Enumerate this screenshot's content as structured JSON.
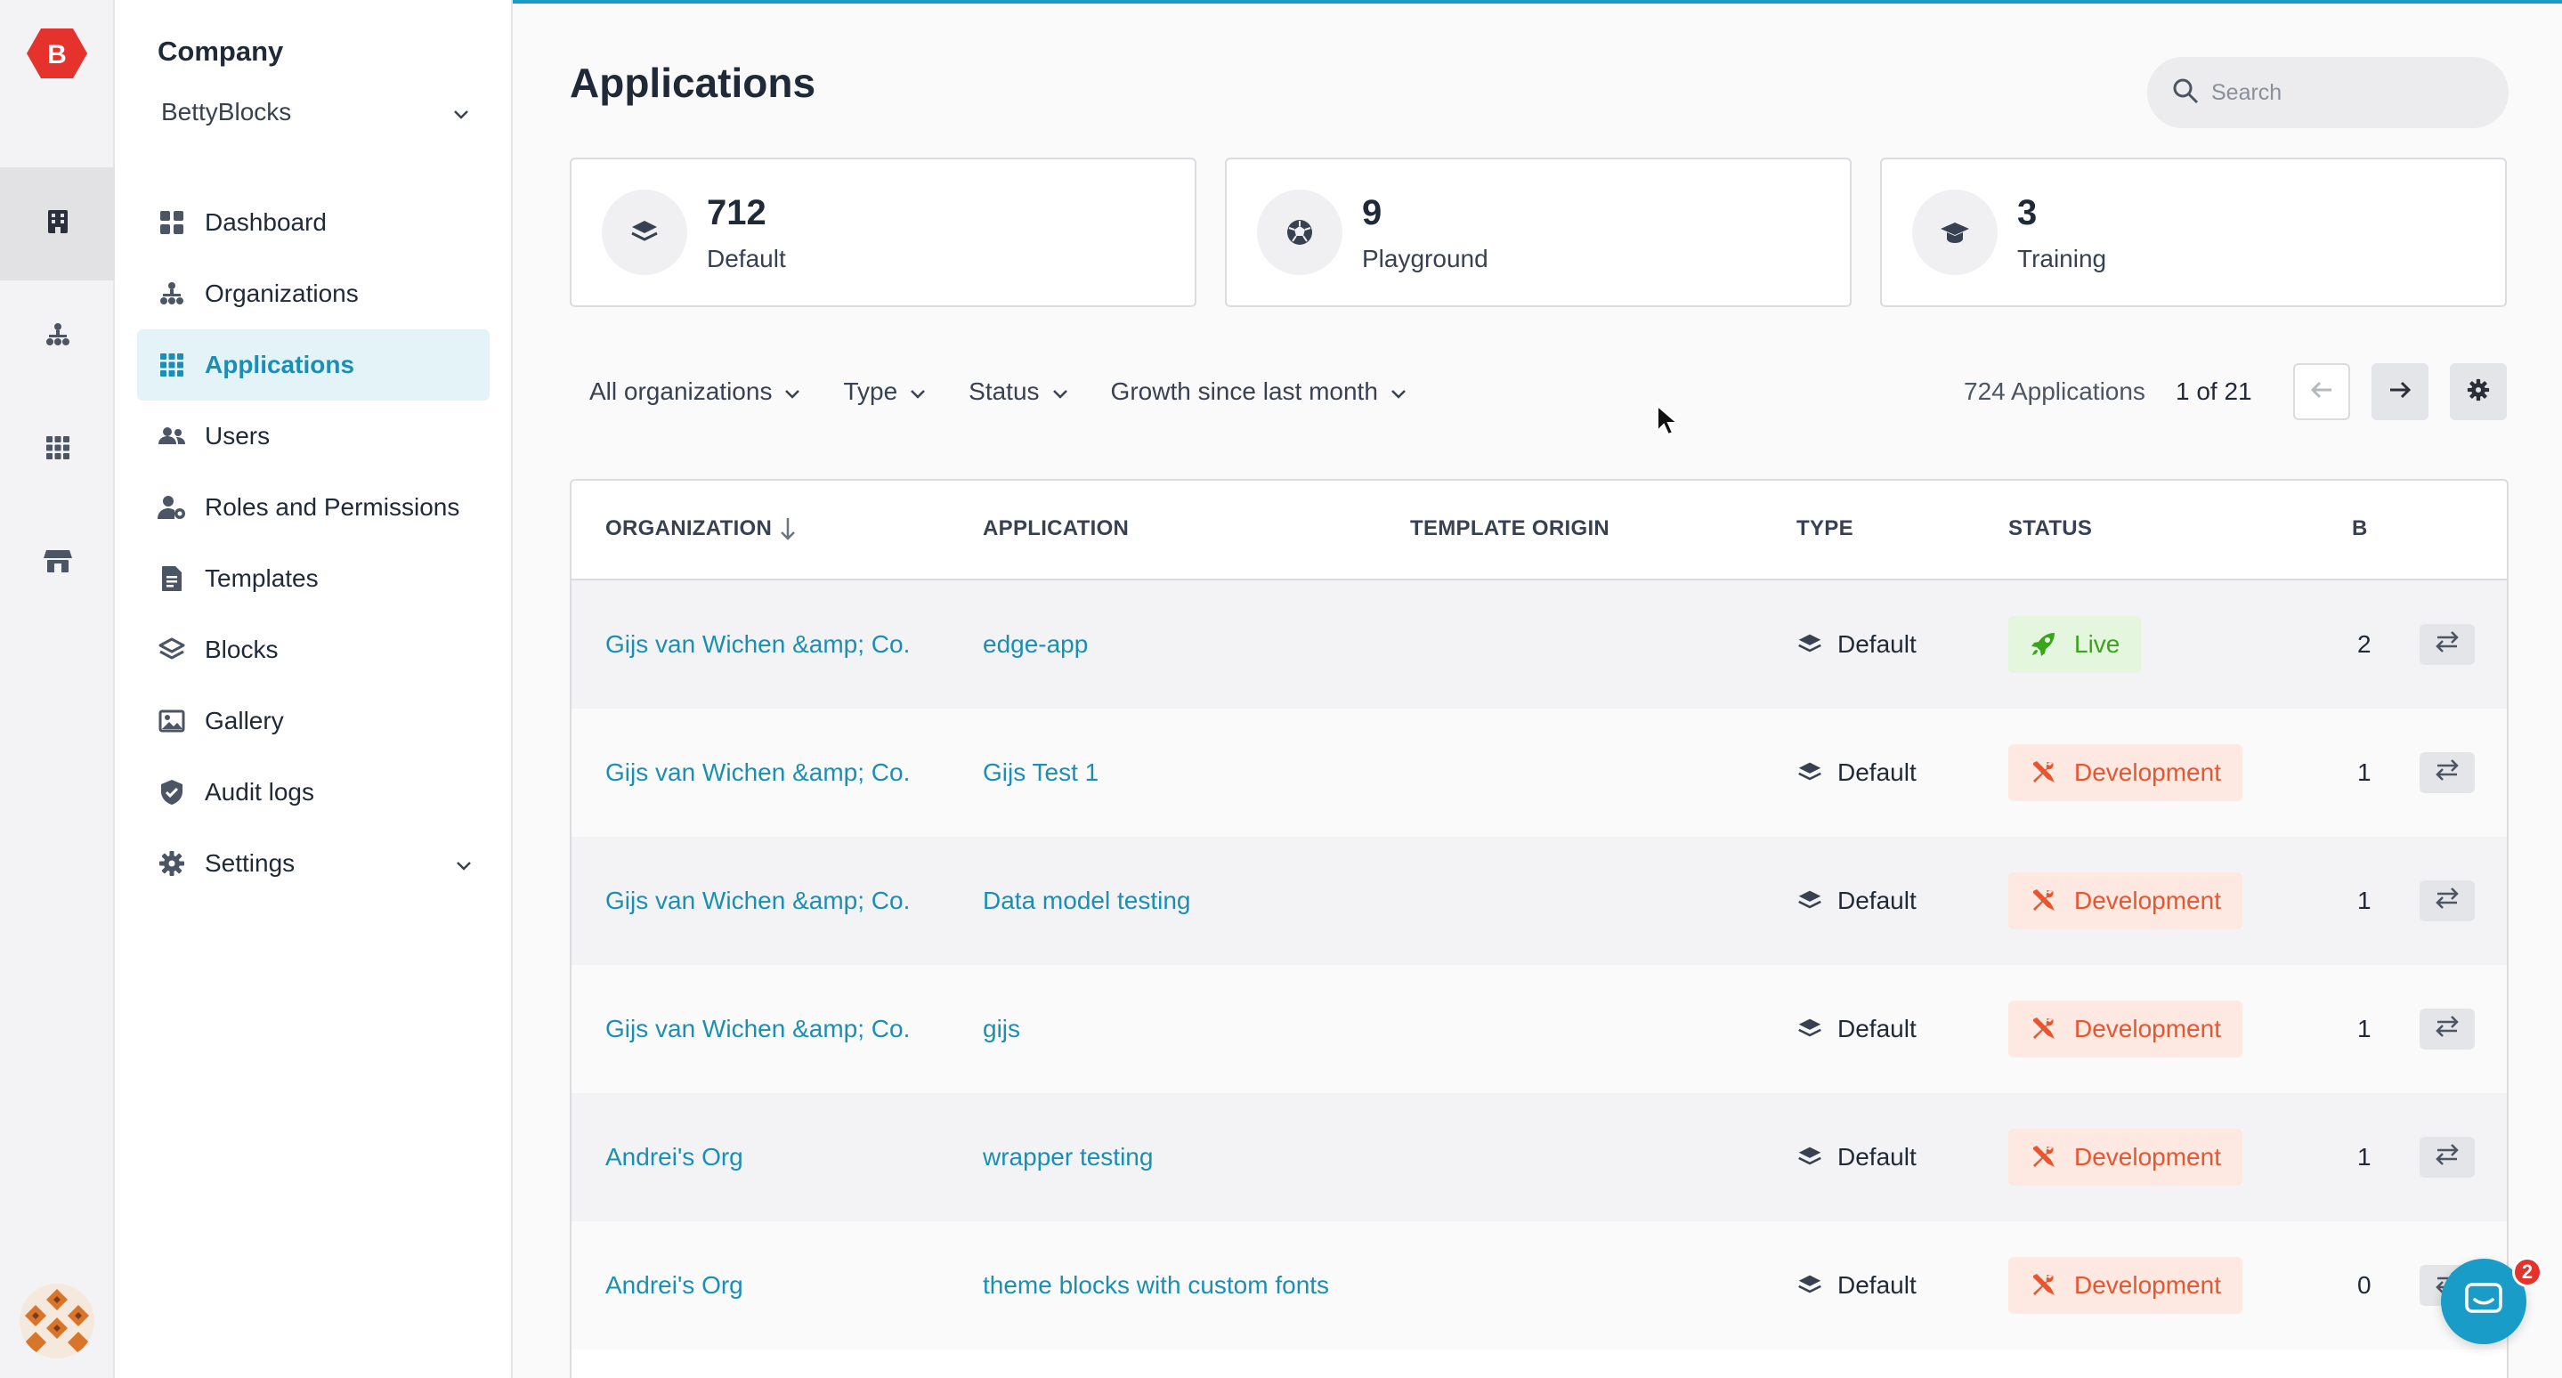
{
  "rail": {
    "logo_letter": "B",
    "items": [
      "building-icon",
      "org-tree-icon",
      "apps-grid-icon",
      "store-icon"
    ]
  },
  "sidebar": {
    "title": "Company",
    "company": "BettyBlocks",
    "items": [
      {
        "label": "Dashboard",
        "icon": "dashboard-icon"
      },
      {
        "label": "Organizations",
        "icon": "org-tree-icon"
      },
      {
        "label": "Applications",
        "icon": "apps-grid-icon",
        "active": true
      },
      {
        "label": "Users",
        "icon": "users-icon"
      },
      {
        "label": "Roles and Permissions",
        "icon": "user-gear-icon"
      },
      {
        "label": "Templates",
        "icon": "document-icon"
      },
      {
        "label": "Blocks",
        "icon": "layers-icon"
      },
      {
        "label": "Gallery",
        "icon": "image-icon"
      },
      {
        "label": "Audit logs",
        "icon": "shield-check-icon"
      },
      {
        "label": "Settings",
        "icon": "gear-icon"
      }
    ]
  },
  "main": {
    "title": "Applications",
    "search_placeholder": "Search",
    "stats": [
      {
        "value": "712",
        "label": "Default",
        "icon": "layers-icon"
      },
      {
        "value": "9",
        "label": "Playground",
        "icon": "ball-icon"
      },
      {
        "value": "3",
        "label": "Training",
        "icon": "graduation-cap-icon"
      }
    ],
    "filters": [
      "All organizations",
      "Type",
      "Status",
      "Growth since last month"
    ],
    "count": "724 Applications",
    "page": "1 of 21",
    "columns": {
      "organization": "ORGANIZATION",
      "application": "APPLICATION",
      "template_origin": "TEMPLATE ORIGIN",
      "type": "TYPE",
      "status": "STATUS",
      "b": "B"
    },
    "rows": [
      {
        "org": "Gijs van Wichen &amp; Co.",
        "app": "edge-app",
        "type": "Default",
        "status": "Live",
        "b": "2"
      },
      {
        "org": "Gijs van Wichen &amp; Co.",
        "app": "Gijs Test 1",
        "type": "Default",
        "status": "Development",
        "b": "1"
      },
      {
        "org": "Gijs van Wichen &amp; Co.",
        "app": "Data model testing",
        "type": "Default",
        "status": "Development",
        "b": "1"
      },
      {
        "org": "Gijs van Wichen &amp; Co.",
        "app": "gijs",
        "type": "Default",
        "status": "Development",
        "b": "1"
      },
      {
        "org": "Andrei's Org",
        "app": "wrapper testing",
        "type": "Default",
        "status": "Development",
        "b": "1"
      },
      {
        "org": "Andrei's Org",
        "app": "theme blocks with custom fonts",
        "type": "Default",
        "status": "Development",
        "b": "0"
      }
    ]
  },
  "chat": {
    "unread": "2"
  },
  "colors": {
    "accent": "#1a8fb5",
    "brand_red": "#e5322d",
    "live_bg": "#e4f6dd",
    "live_fg": "#3aa51c",
    "dev_bg": "#fde8e2",
    "dev_fg": "#e8552e"
  }
}
